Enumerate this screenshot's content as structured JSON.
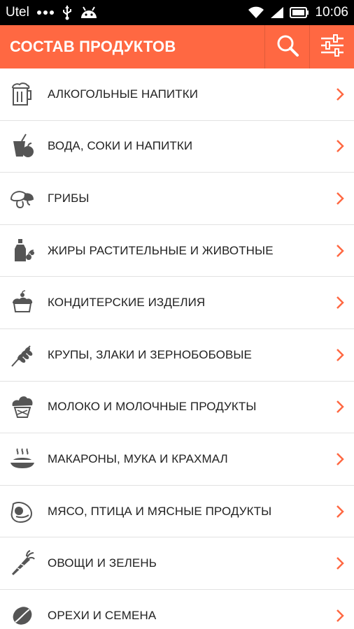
{
  "status_bar": {
    "carrier": "Utel",
    "time": "10:06",
    "icons": [
      "more-dots-icon",
      "usb-icon",
      "android-icon",
      "wifi-icon",
      "signal-icon",
      "battery-icon"
    ]
  },
  "app_bar": {
    "title": "СОСТАВ ПРОДУКТОВ",
    "actions": [
      "search-icon",
      "filter-sliders-icon"
    ],
    "color": "#FF6842"
  },
  "categories": [
    {
      "label": "АЛКОГОЛЬНЫЕ НАПИТКИ",
      "icon": "beer-mug-icon"
    },
    {
      "label": "ВОДА, СОКИ И НАПИТКИ",
      "icon": "juice-apple-icon"
    },
    {
      "label": "ГРИБЫ",
      "icon": "mushroom-icon"
    },
    {
      "label": "ЖИРЫ РАСТИТЕЛЬНЫЕ И ЖИВОТНЫЕ",
      "icon": "oil-bottle-icon"
    },
    {
      "label": "КОНДИТЕРСКИЕ ИЗДЕЛИЯ",
      "icon": "cake-icon"
    },
    {
      "label": "КРУПЫ, ЗЛАКИ И ЗЕРНОБОБОВЫЕ",
      "icon": "wheat-icon"
    },
    {
      "label": "МОЛОКО И МОЛОЧНЫЕ ПРОДУКТЫ",
      "icon": "ice-cream-icon"
    },
    {
      "label": "МАКАРОНЫ, МУКА И КРАХМАЛ",
      "icon": "pasta-plate-icon"
    },
    {
      "label": "МЯСО, ПТИЦА И МЯСНЫЕ ПРОДУКТЫ",
      "icon": "meat-ham-icon"
    },
    {
      "label": "ОВОЩИ И ЗЕЛЕНЬ",
      "icon": "carrot-icon"
    },
    {
      "label": "ОРЕХИ И СЕМЕНА",
      "icon": "seed-icon"
    }
  ],
  "colors": {
    "accent": "#FF6842",
    "icon_gray": "#555555",
    "chevron": "#FF6842"
  }
}
